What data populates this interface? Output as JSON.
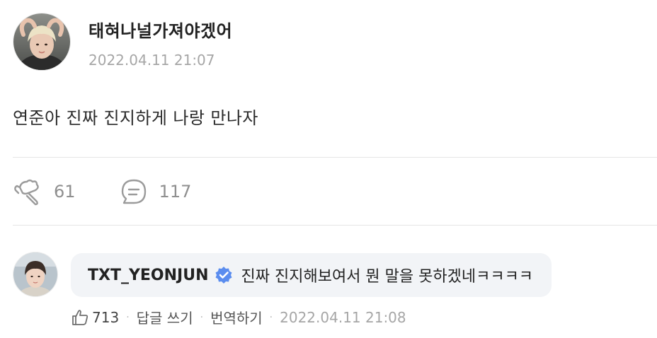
{
  "post": {
    "author": "태혀나널가져야겠어",
    "date": "2022.04.11 21:07",
    "body": "연준아 진짜 진지하게 나랑 만나자",
    "likes": "61",
    "comments": "117"
  },
  "comment": {
    "author": "TXT_YEONJUN",
    "text": "진짜 진지해보여서 뭔 말을 못하겠네ㅋㅋㅋㅋ",
    "likes": "713",
    "reply_label": "답글 쓰기",
    "translate_label": "번역하기",
    "date": "2022.04.11 21:08",
    "separator": "·"
  },
  "colors": {
    "verified": "#5b8def",
    "bubble": "#f2f4f7",
    "muted": "#a6a6a6"
  },
  "icons": {
    "like": "hand-heart-icon",
    "comment": "speech-bubble-icon",
    "verified": "verified-badge-icon",
    "comment_like": "thumbs-up-icon"
  }
}
